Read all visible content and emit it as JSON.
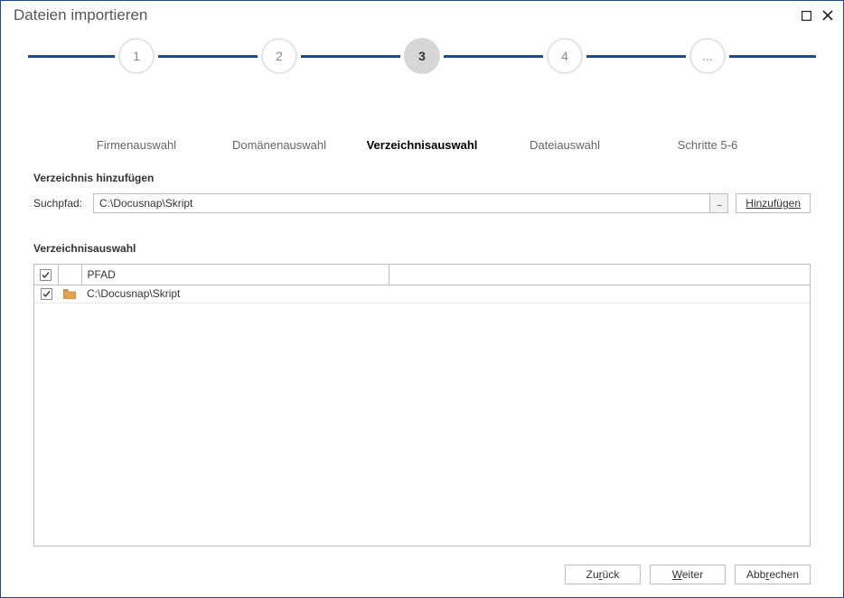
{
  "window": {
    "title": "Dateien importieren"
  },
  "stepper": {
    "steps": [
      {
        "num": "1",
        "label": "Firmenauswahl"
      },
      {
        "num": "2",
        "label": "Domänenauswahl"
      },
      {
        "num": "3",
        "label": "Verzeichnisauswahl"
      },
      {
        "num": "4",
        "label": "Dateiauswahl"
      },
      {
        "num": "...",
        "label": "Schritte 5-6"
      }
    ],
    "current_index": 2
  },
  "add_section": {
    "title": "Verzeichnis hinzufügen",
    "field_label": "Suchpfad:",
    "path_value": "C:\\Docusnap\\Skript",
    "browse_label": "...",
    "add_button": "Hinzufügen"
  },
  "table_section": {
    "title": "Verzeichnisauswahl",
    "header_path": "PFAD",
    "rows": [
      {
        "checked": true,
        "path": "C:\\Docusnap\\Skript"
      }
    ]
  },
  "footer": {
    "back_pre": "Zu",
    "back_mn": "r",
    "back_post": "ück",
    "next_mn": "W",
    "next_post": "eiter",
    "cancel_pre": "Abb",
    "cancel_mn": "r",
    "cancel_post": "echen"
  }
}
